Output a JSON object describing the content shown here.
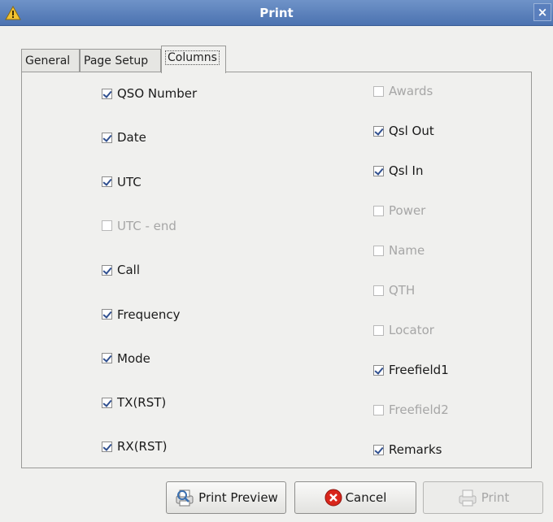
{
  "window": {
    "title": "Print",
    "close_glyph": "×"
  },
  "tabs": [
    {
      "label": "General",
      "active": false
    },
    {
      "label": "Page Setup",
      "active": false
    },
    {
      "label": "Columns",
      "active": true
    }
  ],
  "left_column": [
    {
      "label": "QSO Number",
      "checked": true,
      "enabled": true
    },
    {
      "label": "Date",
      "checked": true,
      "enabled": true
    },
    {
      "label": "UTC",
      "checked": true,
      "enabled": true
    },
    {
      "label": "UTC - end",
      "checked": false,
      "enabled": false
    },
    {
      "label": "Call",
      "checked": true,
      "enabled": true
    },
    {
      "label": "Frequency",
      "checked": true,
      "enabled": true
    },
    {
      "label": "Mode",
      "checked": true,
      "enabled": true
    },
    {
      "label": "TX(RST)",
      "checked": true,
      "enabled": true
    },
    {
      "label": "RX(RST)",
      "checked": true,
      "enabled": true
    }
  ],
  "right_column": [
    {
      "label": "Awards",
      "checked": false,
      "enabled": false
    },
    {
      "label": "Qsl Out",
      "checked": true,
      "enabled": true
    },
    {
      "label": "Qsl In",
      "checked": true,
      "enabled": true
    },
    {
      "label": "Power",
      "checked": false,
      "enabled": false
    },
    {
      "label": "Name",
      "checked": false,
      "enabled": false
    },
    {
      "label": "QTH",
      "checked": false,
      "enabled": false
    },
    {
      "label": "Locator",
      "checked": false,
      "enabled": false
    },
    {
      "label": "Freefield1",
      "checked": true,
      "enabled": true
    },
    {
      "label": "Freefield2",
      "checked": false,
      "enabled": false
    },
    {
      "label": "Remarks",
      "checked": true,
      "enabled": true
    }
  ],
  "buttons": {
    "preview_label": "Print Preview",
    "cancel_label": "Cancel",
    "print_label": "Print",
    "preview_icon": "print-preview-icon",
    "cancel_icon": "cancel-icon",
    "print_icon": "printer-icon"
  },
  "colors": {
    "titlebar": "#4b72b0",
    "checkmark": "#2f4f8f",
    "cancel_red": "#d9261c",
    "disabled_text": "#a6a6a6"
  }
}
